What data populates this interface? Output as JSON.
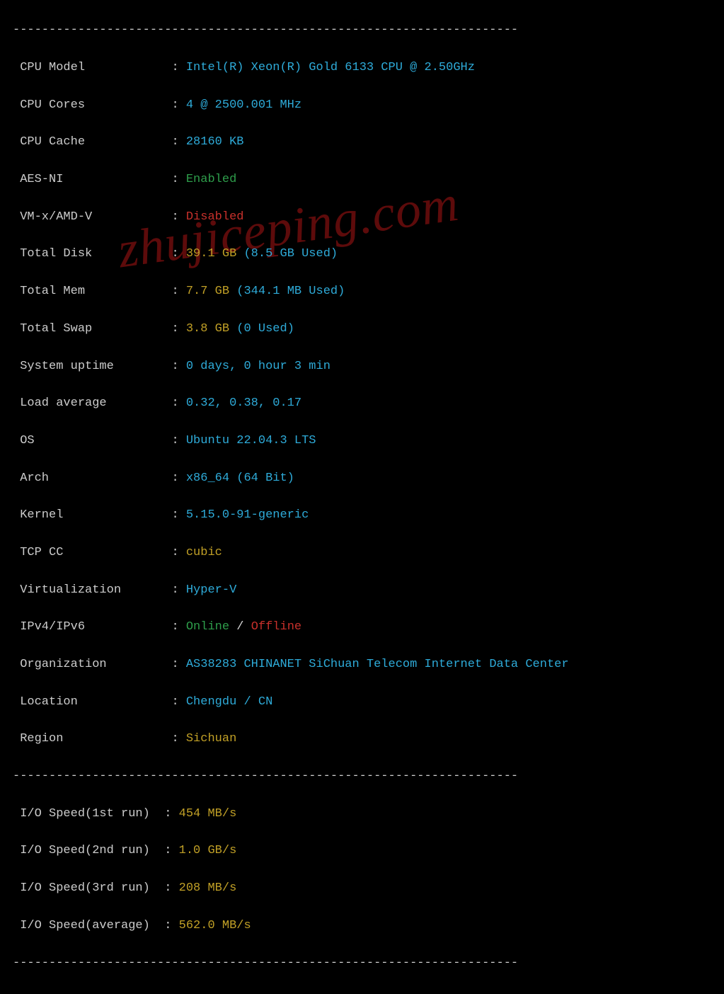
{
  "divider": "----------------------------------------------------------------------",
  "watermark": "zhujiceping.com",
  "labels": {
    "cpu_model": "CPU Model",
    "cpu_cores": "CPU Cores",
    "cpu_cache": "CPU Cache",
    "aes_ni": "AES-NI",
    "vmx": "VM-x/AMD-V",
    "total_disk": "Total Disk",
    "total_mem": "Total Mem",
    "total_swap": "Total Swap",
    "uptime": "System uptime",
    "load": "Load average",
    "os": "OS",
    "arch": "Arch",
    "kernel": "Kernel",
    "tcpcc": "TCP CC",
    "virt": "Virtualization",
    "ip": "IPv4/IPv6",
    "org": "Organization",
    "loc": "Location",
    "region": "Region",
    "io1": "I/O Speed(1st run)",
    "io2": "I/O Speed(2nd run)",
    "io3": "I/O Speed(3rd run)",
    "ioavg": "I/O Speed(average)"
  },
  "values": {
    "cpu_model": "Intel(R) Xeon(R) Gold 6133 CPU @ 2.50GHz",
    "cpu_cores": "4 @ 2500.001 MHz",
    "cpu_cache": "28160 KB",
    "aes_ni": "Enabled",
    "vmx": "Disabled",
    "disk_a": "39.1 GB",
    "disk_b": "(8.5 GB Used)",
    "mem_a": "7.7 GB",
    "mem_b": "(344.1 MB Used)",
    "swap_a": "3.8 GB",
    "swap_b": "(0 Used)",
    "uptime": "0 days, 0 hour 3 min",
    "load": "0.32, 0.38, 0.17",
    "os": "Ubuntu 22.04.3 LTS",
    "arch": "x86_64 (64 Bit)",
    "kernel": "5.15.0-91-generic",
    "tcpcc": "cubic",
    "virt": "Hyper-V",
    "ipv4": "Online",
    "ip_sep": " / ",
    "ipv6": "Offline",
    "org": "AS38283 CHINANET SiChuan Telecom Internet Data Center",
    "loc": "Chengdu / CN",
    "region": "Sichuan",
    "io1": "454 MB/s",
    "io2": "1.0 GB/s",
    "io3": "208 MB/s",
    "ioavg": "562.0 MB/s"
  }
}
